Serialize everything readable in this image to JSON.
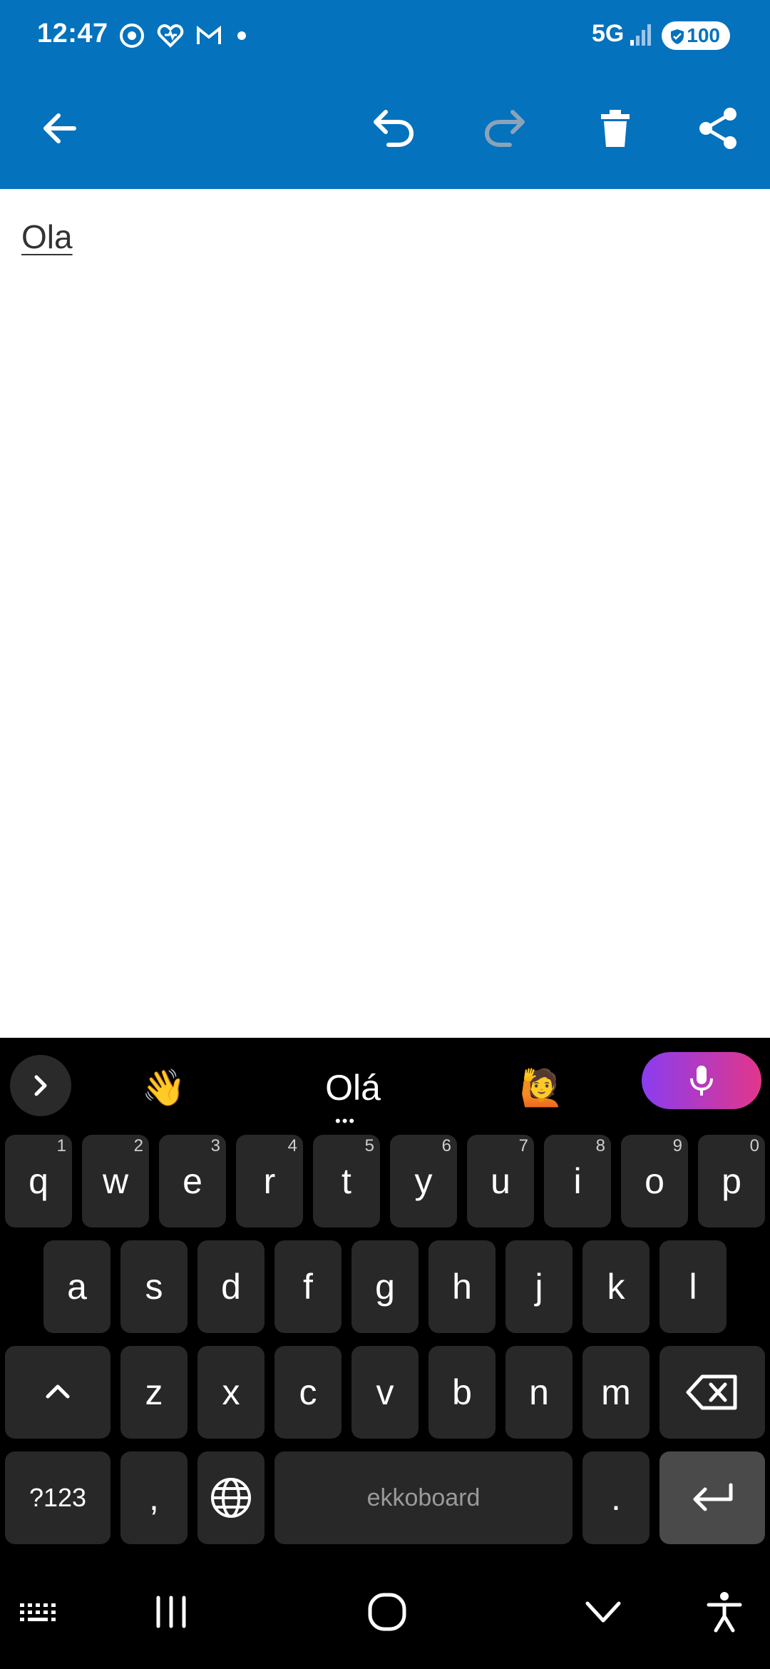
{
  "status_bar": {
    "time": "12:47",
    "network": "5G",
    "battery": "100",
    "icons": [
      "chrome-icon",
      "health-heart-icon",
      "gmail-icon",
      "notification-dot-icon",
      "signal-bars-icon",
      "battery-shield-icon"
    ]
  },
  "app_bar": {
    "color": "#0472BD",
    "actions": [
      "back-arrow-icon",
      "undo-icon",
      "redo-icon",
      "delete-icon",
      "share-icon"
    ]
  },
  "editor": {
    "text": "Ola"
  },
  "keyboard": {
    "suggestions": {
      "left_emoji": "👋",
      "word": "Olá",
      "right_emoji": "🙋",
      "dots": "•••"
    },
    "rows": [
      [
        {
          "k": "q",
          "h": "1"
        },
        {
          "k": "w",
          "h": "2"
        },
        {
          "k": "e",
          "h": "3"
        },
        {
          "k": "r",
          "h": "4"
        },
        {
          "k": "t",
          "h": "5"
        },
        {
          "k": "y",
          "h": "6"
        },
        {
          "k": "u",
          "h": "7"
        },
        {
          "k": "i",
          "h": "8"
        },
        {
          "k": "o",
          "h": "9"
        },
        {
          "k": "p",
          "h": "0"
        }
      ],
      [
        "a",
        "s",
        "d",
        "f",
        "g",
        "h",
        "j",
        "k",
        "l"
      ],
      [
        "z",
        "x",
        "c",
        "v",
        "b",
        "n",
        "m"
      ]
    ],
    "symbols_label": "?123",
    "comma_label": ",",
    "period_label": ".",
    "space_label": "ekkoboard"
  },
  "nav_bar": {
    "buttons": [
      "keyboard-toggle-icon",
      "recents-icon",
      "home-icon",
      "hide-keyboard-icon",
      "accessibility-icon"
    ]
  }
}
